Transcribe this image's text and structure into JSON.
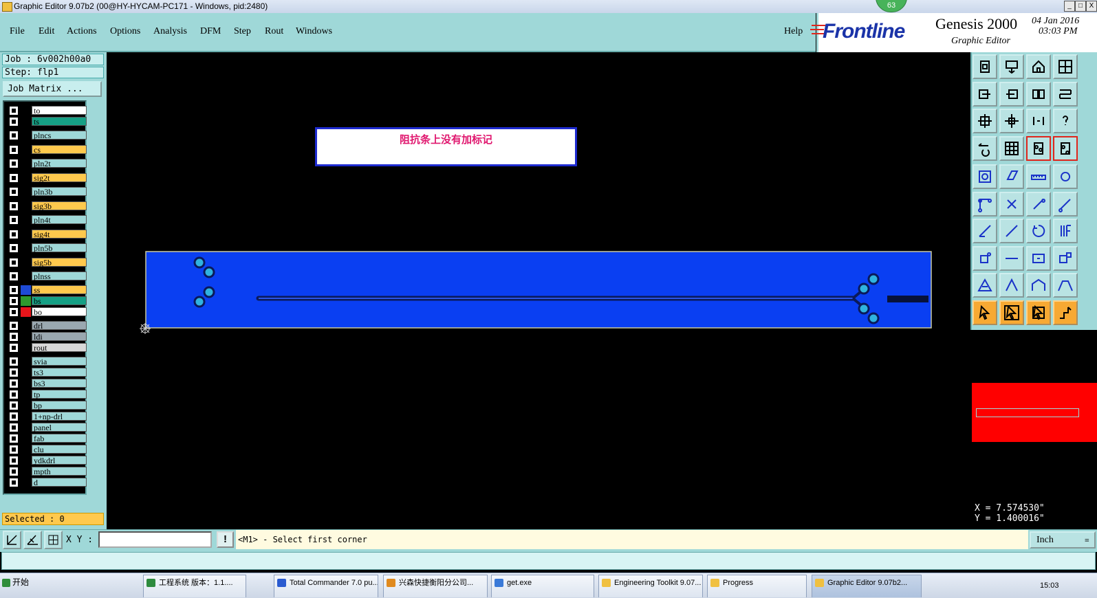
{
  "window": {
    "title": "Graphic Editor 9.07b2 (00@HY-HYCAM-PC171 - Windows, pid:2480)",
    "badge": "63",
    "buttons": [
      "_",
      "□",
      "X"
    ]
  },
  "menubar": {
    "items": [
      "File",
      "Edit",
      "Actions",
      "Options",
      "Analysis",
      "DFM",
      "Step",
      "Rout",
      "Windows"
    ],
    "help": "Help"
  },
  "brand": {
    "logo": "Frontline",
    "product": "Genesis 2000",
    "subtitle": "Graphic Editor",
    "date": "04 Jan 2016",
    "time": "03:03 PM"
  },
  "job": {
    "job_label": "Job : 6v002h00a0",
    "step_label": "Step: flp1",
    "job_matrix": "Job Matrix ..."
  },
  "layers": [
    {
      "name": "to",
      "color": "#ffffff",
      "swatch": "#000000",
      "group": 0
    },
    {
      "name": "ts",
      "color": "#16a085",
      "swatch": "#000000",
      "group": 0
    },
    {
      "name": "plncs",
      "color": "#9fd8d8",
      "swatch": "#000000",
      "group": 1
    },
    {
      "name": "cs",
      "color": "#ffc94d",
      "swatch": "#000000",
      "group": 1
    },
    {
      "name": "pln2t",
      "color": "#9fd8d8",
      "swatch": "#000000",
      "group": 1
    },
    {
      "name": "sig2t",
      "color": "#ffc94d",
      "swatch": "#000000",
      "group": 1
    },
    {
      "name": "pln3b",
      "color": "#9fd8d8",
      "swatch": "#000000",
      "group": 1
    },
    {
      "name": "sig3b",
      "color": "#ffc94d",
      "swatch": "#000000",
      "group": 1
    },
    {
      "name": "pln4t",
      "color": "#9fd8d8",
      "swatch": "#000000",
      "group": 1
    },
    {
      "name": "sig4t",
      "color": "#ffc94d",
      "swatch": "#000000",
      "group": 1
    },
    {
      "name": "pln5b",
      "color": "#9fd8d8",
      "swatch": "#000000",
      "group": 1
    },
    {
      "name": "sig5b",
      "color": "#ffc94d",
      "swatch": "#000000",
      "group": 1
    },
    {
      "name": "plnss",
      "color": "#9fd8d8",
      "swatch": "#000000",
      "group": 1
    },
    {
      "name": "ss",
      "color": "#ffc94d",
      "swatch": "#1e4bd6",
      "group": 2
    },
    {
      "name": "bs",
      "color": "#16a085",
      "swatch": "#2e9a2e",
      "group": 2
    },
    {
      "name": "bo",
      "color": "#ffffff",
      "swatch": "#e8151b",
      "group": 2
    },
    {
      "name": "drl",
      "color": "#9aa8b0",
      "swatch": "#000000",
      "group": 3
    },
    {
      "name": "ldi",
      "color": "#9aa8b0",
      "swatch": "#000000",
      "group": 3
    },
    {
      "name": "rout",
      "color": "#d8d8d8",
      "swatch": "#000000",
      "group": 3
    },
    {
      "name": "svia",
      "color": "#9fd8d8",
      "swatch": "#000000",
      "group": 4
    },
    {
      "name": "ts3",
      "color": "#9fd8d8",
      "swatch": "#000000",
      "group": 4
    },
    {
      "name": "bs3",
      "color": "#9fd8d8",
      "swatch": "#000000",
      "group": 4
    },
    {
      "name": "tp",
      "color": "#9fd8d8",
      "swatch": "#000000",
      "group": 4
    },
    {
      "name": "bp",
      "color": "#9fd8d8",
      "swatch": "#000000",
      "group": 4
    },
    {
      "name": "1+np-drl",
      "color": "#9fd8d8",
      "swatch": "#000000",
      "group": 4
    },
    {
      "name": "panel",
      "color": "#9fd8d8",
      "swatch": "#000000",
      "group": 4
    },
    {
      "name": "fab",
      "color": "#9fd8d8",
      "swatch": "#000000",
      "group": 4
    },
    {
      "name": "clu",
      "color": "#9fd8d8",
      "swatch": "#000000",
      "group": 4
    },
    {
      "name": "ydkdrl",
      "color": "#9fd8d8",
      "swatch": "#000000",
      "group": 4
    },
    {
      "name": "mpth",
      "color": "#9fd8d8",
      "swatch": "#000000",
      "group": 4
    },
    {
      "name": "d",
      "color": "#9fd8d8",
      "swatch": "#000000",
      "group": 4
    }
  ],
  "selected": "Selected : 0",
  "canvas": {
    "note": "阻抗条上没有加标记",
    "board_color": "#0a3ff2"
  },
  "coords": {
    "x": "X = 7.574530\"",
    "y": "Y = 1.400016\""
  },
  "status": {
    "xy_label": "X Y :",
    "xy_value": "",
    "warn": "!",
    "prompt": "<M1> - Select first corner",
    "units": "Inch"
  },
  "taskbar": {
    "start": "开始",
    "tasks": [
      {
        "label": "工程系统  版本：1.1....",
        "icon": "#2e8b3e"
      },
      {
        "label": "Total Commander 7.0 pu...",
        "icon": "#2a5bd0"
      },
      {
        "label": "兴森快捷衡阳分公司...",
        "icon": "#e08a1e"
      },
      {
        "label": "get.exe",
        "icon": "#3a7ad8"
      },
      {
        "label": "Engineering Toolkit 9.07...",
        "icon": "#f0c040"
      },
      {
        "label": "Progress",
        "icon": "#f0c040"
      },
      {
        "label": "Graphic Editor 9.07b2...",
        "icon": "#f0c040"
      }
    ],
    "clock": "15:03"
  },
  "toolbox_icons": [
    "save-up-icon",
    "save-down-icon",
    "home-icon",
    "layers-grid-icon",
    "move-left-icon",
    "move-right-icon",
    "flip-icon",
    "snake-icon",
    "zoom-fit-icon",
    "zoom-home-icon",
    "ratio-icon",
    "help-icon",
    "measure-icon",
    "grid-icon",
    "drc-icon",
    "drc-alt-icon",
    "pad-icon",
    "parallelogram-icon",
    "ruler-icon",
    "circle-pad-icon",
    "connect-icon",
    "cross-icon",
    "line-point-icon",
    "line-node-icon",
    "slope-icon",
    "diagonal-icon",
    "arc-icon",
    "text-icon",
    "node-add-icon",
    "minus-line-icon",
    "clip-icon",
    "polygon-icon",
    "triangle-icon",
    "peak-icon",
    "bridge-icon",
    "trapezoid-icon",
    "pointer-icon",
    "pointer-box-icon",
    "pointer-select-icon",
    "route-icon"
  ]
}
